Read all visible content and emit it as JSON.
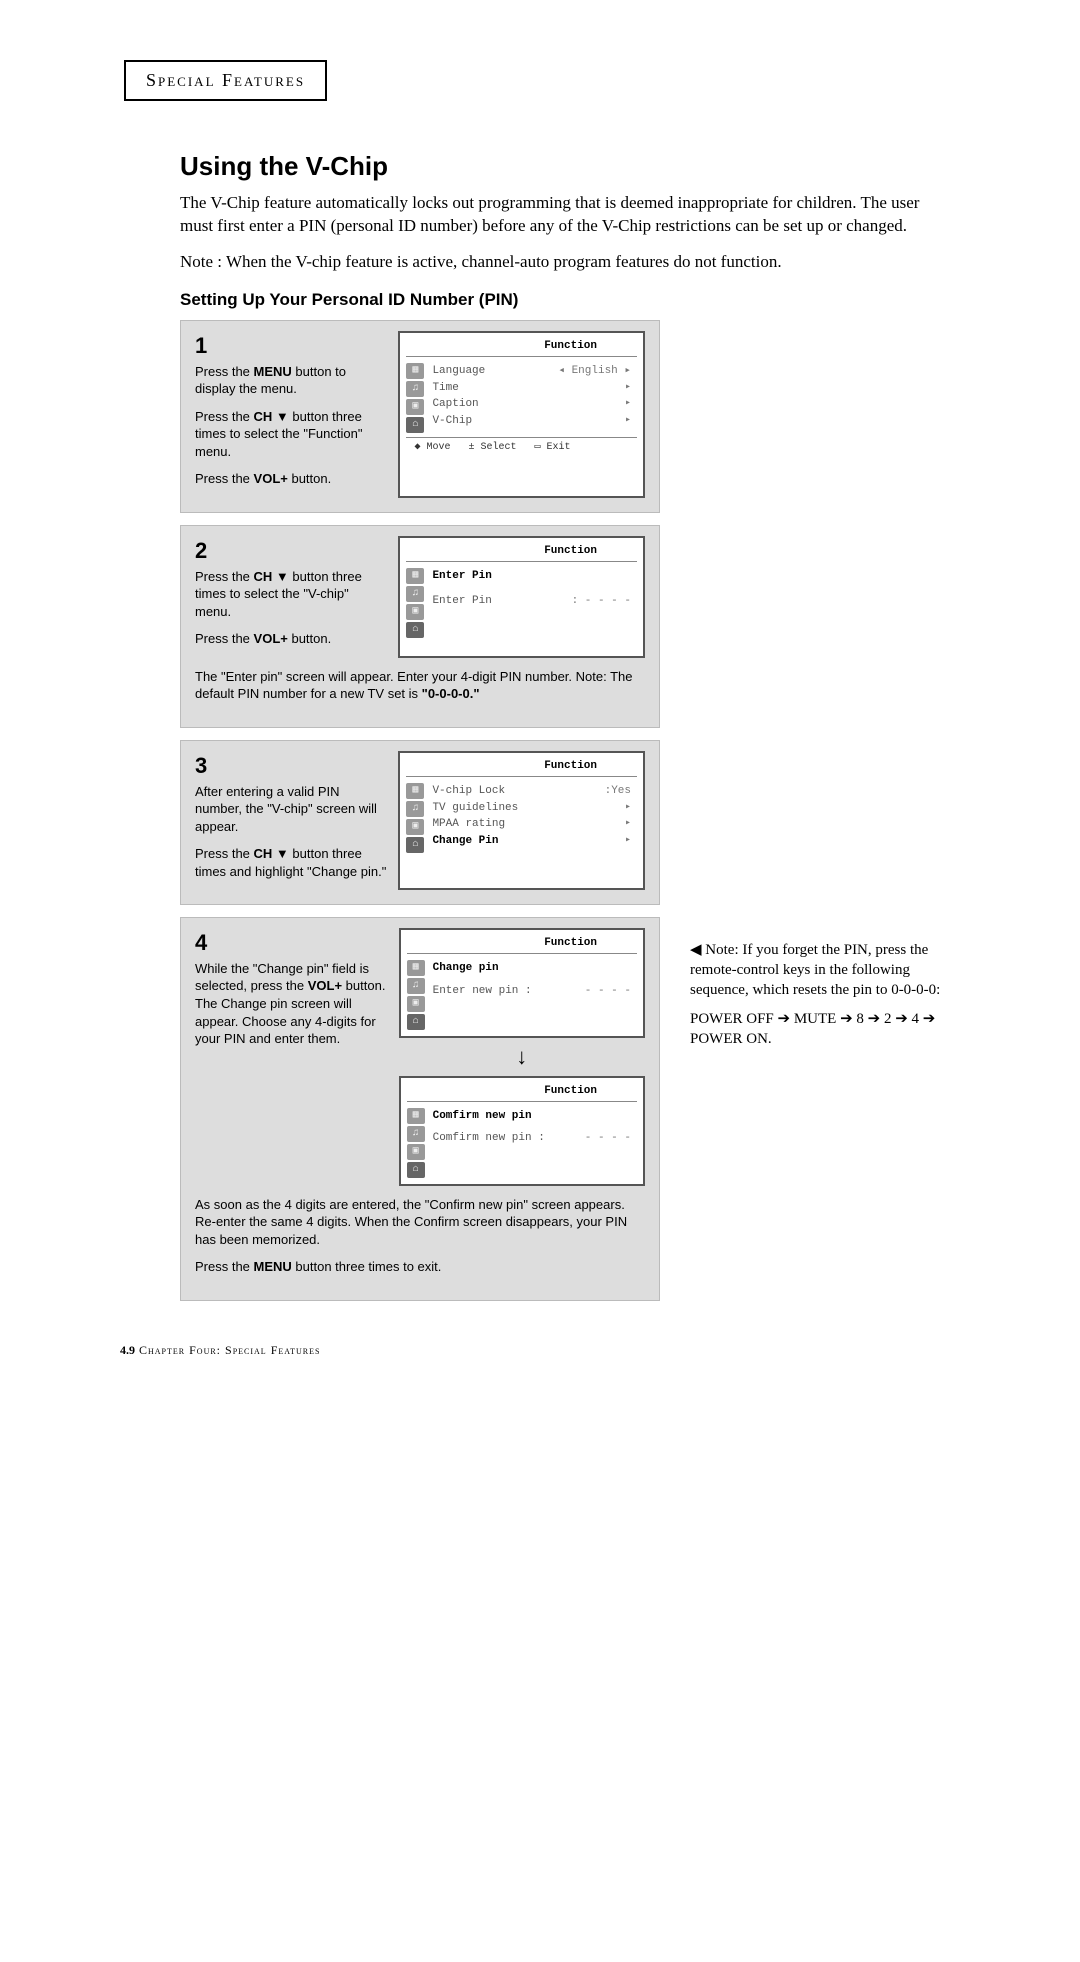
{
  "header": "Special Features",
  "title": "Using the V-Chip",
  "intro": "The V-Chip feature automatically locks out programming that is deemed inappropriate for children. The user must first enter a PIN (personal ID number) before any of the V-Chip restrictions can be set up or changed.",
  "note": "Note : When the V-chip feature is active, channel-auto program features do not function.",
  "subhead": "Setting Up Your Personal ID Number (PIN)",
  "steps": {
    "s1": {
      "num": "1",
      "p1a": "Press the ",
      "p1b": "MENU",
      "p1c": " button to display the menu.",
      "p2a": "Press the ",
      "p2b": "CH ▼",
      "p2c": "  button three times to select the \"Function\" menu.",
      "p3a": "Press the ",
      "p3b": "VOL+",
      "p3c": " button.",
      "osd": {
        "title": "Function",
        "rows": [
          {
            "lab": "Language",
            "val": "◂ English ▸"
          },
          {
            "lab": "Time",
            "val": "▸"
          },
          {
            "lab": "Caption",
            "val": "▸"
          },
          {
            "lab": "V-Chip",
            "val": "▸"
          }
        ],
        "foot": [
          "◆ Move",
          "± Select",
          "▭ Exit"
        ]
      }
    },
    "s2": {
      "num": "2",
      "p1a": "Press the ",
      "p1b": "CH ▼",
      "p1c": " button three times to select  the \"V-chip\" menu.",
      "p2a": "Press the ",
      "p2b": "VOL+",
      "p2c": " button.",
      "bottom1": "The \"Enter pin\" screen will appear. Enter your 4-digit PIN number. Note: The default PIN number for a new TV set is ",
      "bottom2": "\"0-0-0-0.\"",
      "osd": {
        "title": "Function",
        "rows": [
          {
            "lab": "Enter Pin",
            "val": ""
          },
          {
            "lab": "Enter Pin",
            "val": ": - - - -"
          }
        ]
      }
    },
    "s3": {
      "num": "3",
      "p1a": "After entering a valid PIN number, the \"V-chip\" screen will appear.",
      "p2a": "Press the ",
      "p2b": "CH ▼",
      "p2c": " button three times and highlight \"Change pin.\"",
      "osd": {
        "title": "Function",
        "rows": [
          {
            "lab": "V-chip Lock",
            "val": ":Yes"
          },
          {
            "lab": "TV guidelines",
            "val": "▸"
          },
          {
            "lab": "MPAA rating",
            "val": "▸"
          },
          {
            "lab": "Change Pin",
            "val": "▸",
            "sel": true
          }
        ]
      }
    },
    "s4": {
      "num": "4",
      "p1a": "While the \"Change pin\" field is selected, press the ",
      "p1b": "VOL+",
      "p1c": " button.  The Change pin screen will appear. Choose any 4-digits for your PIN and enter them.",
      "osd1": {
        "title": "Function",
        "rows": [
          {
            "lab": "Change pin",
            "val": ""
          },
          {
            "lab": "Enter new pin :",
            "val": "- - - -"
          }
        ]
      },
      "arrow": "↓",
      "osd2": {
        "title": "Function",
        "rows": [
          {
            "lab": "Comfirm new pin",
            "val": ""
          },
          {
            "lab": "Comfirm new pin :",
            "val": "- - - -"
          }
        ]
      },
      "bottom1": "As soon as the 4 digits are entered, the \"Confirm new pin\" screen appears. Re-enter the same 4 digits. When the Confirm screen disappears, your PIN has been memorized.",
      "bottom2a": "Press the ",
      "bottom2b": "MENU",
      "bottom2c": " button three times to exit."
    }
  },
  "side": {
    "p1": "◀   Note: If you forget the PIN, press the remote-control keys in the following sequence, which resets the pin to 0-0-0-0:",
    "p2": "POWER OFF ➔ MUTE ➔ 8 ➔ 2 ➔ 4 ➔ POWER ON."
  },
  "footer": {
    "pn": "4.9",
    "txt": " Chapter Four: Special Features"
  }
}
